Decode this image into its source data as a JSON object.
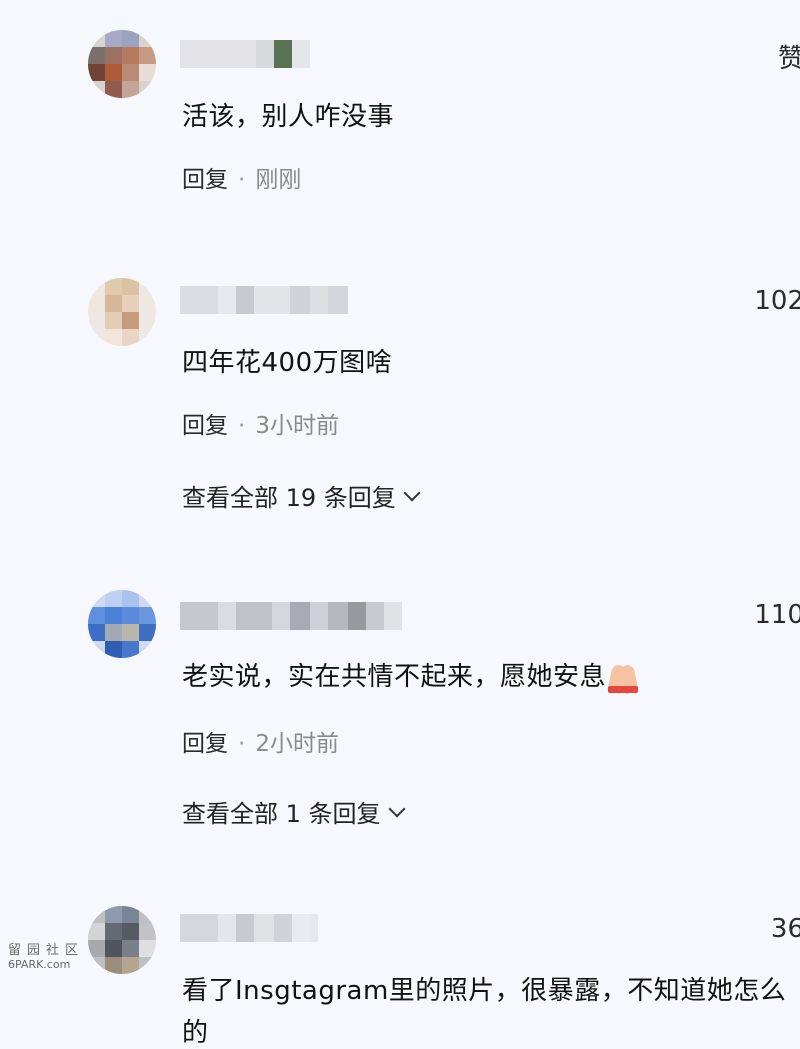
{
  "comments": [
    {
      "text": "活该，别人咋没事",
      "reply_label": "回复",
      "separator": "·",
      "time": "刚刚",
      "likes": "赞"
    },
    {
      "text": "四年花400万图啥",
      "reply_label": "回复",
      "separator": "·",
      "time": "3小时前",
      "likes": "102",
      "view_replies": "查看全部 19 条回复"
    },
    {
      "text": "老实说，实在共情不起来，愿她安息",
      "emoji": "folded-hands-emoji",
      "reply_label": "回复",
      "separator": "·",
      "time": "2小时前",
      "likes": "110",
      "view_replies": "查看全部 1 条回复"
    },
    {
      "text": "看了Insgtagram里的照片，很暴露，不知道她怎么",
      "text_line2": "的",
      "likes": "36"
    }
  ],
  "watermark": {
    "line1": "留园社区",
    "line2": "6PARK.com"
  },
  "icons": {
    "chevron": "chevron-down-icon"
  },
  "colors": {
    "background": "#f7f8fd",
    "text": "#111111",
    "meta": "#8a8a8a"
  }
}
